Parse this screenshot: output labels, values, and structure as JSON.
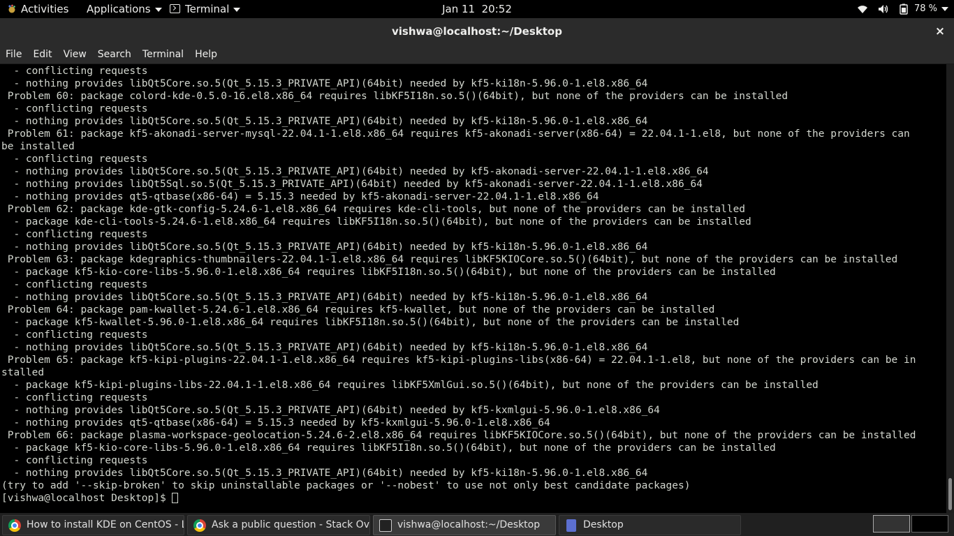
{
  "topbar": {
    "activities": "Activities",
    "applications": "Applications",
    "terminal": "Terminal",
    "clock": "Jan 11  20:52",
    "battery": "78 %"
  },
  "window": {
    "title": "vishwa@localhost:~/Desktop",
    "close": "×"
  },
  "menu": [
    "File",
    "Edit",
    "View",
    "Search",
    "Terminal",
    "Help"
  ],
  "terminal_lines": [
    "  - conflicting requests",
    "  - nothing provides libQt5Core.so.5(Qt_5.15.3_PRIVATE_API)(64bit) needed by kf5-ki18n-5.96.0-1.el8.x86_64",
    " Problem 60: package colord-kde-0.5.0-16.el8.x86_64 requires libKF5I18n.so.5()(64bit), but none of the providers can be installed",
    "  - conflicting requests",
    "  - nothing provides libQt5Core.so.5(Qt_5.15.3_PRIVATE_API)(64bit) needed by kf5-ki18n-5.96.0-1.el8.x86_64",
    " Problem 61: package kf5-akonadi-server-mysql-22.04.1-1.el8.x86_64 requires kf5-akonadi-server(x86-64) = 22.04.1-1.el8, but none of the providers can",
    "be installed",
    "  - conflicting requests",
    "  - nothing provides libQt5Core.so.5(Qt_5.15.3_PRIVATE_API)(64bit) needed by kf5-akonadi-server-22.04.1-1.el8.x86_64",
    "  - nothing provides libQt5Sql.so.5(Qt_5.15.3_PRIVATE_API)(64bit) needed by kf5-akonadi-server-22.04.1-1.el8.x86_64",
    "  - nothing provides qt5-qtbase(x86-64) = 5.15.3 needed by kf5-akonadi-server-22.04.1-1.el8.x86_64",
    " Problem 62: package kde-gtk-config-5.24.6-1.el8.x86_64 requires kde-cli-tools, but none of the providers can be installed",
    "  - package kde-cli-tools-5.24.6-1.el8.x86_64 requires libKF5I18n.so.5()(64bit), but none of the providers can be installed",
    "  - conflicting requests",
    "  - nothing provides libQt5Core.so.5(Qt_5.15.3_PRIVATE_API)(64bit) needed by kf5-ki18n-5.96.0-1.el8.x86_64",
    " Problem 63: package kdegraphics-thumbnailers-22.04.1-1.el8.x86_64 requires libKF5KIOCore.so.5()(64bit), but none of the providers can be installed",
    "  - package kf5-kio-core-libs-5.96.0-1.el8.x86_64 requires libKF5I18n.so.5()(64bit), but none of the providers can be installed",
    "  - conflicting requests",
    "  - nothing provides libQt5Core.so.5(Qt_5.15.3_PRIVATE_API)(64bit) needed by kf5-ki18n-5.96.0-1.el8.x86_64",
    " Problem 64: package pam-kwallet-5.24.6-1.el8.x86_64 requires kf5-kwallet, but none of the providers can be installed",
    "  - package kf5-kwallet-5.96.0-1.el8.x86_64 requires libKF5I18n.so.5()(64bit), but none of the providers can be installed",
    "  - conflicting requests",
    "  - nothing provides libQt5Core.so.5(Qt_5.15.3_PRIVATE_API)(64bit) needed by kf5-ki18n-5.96.0-1.el8.x86_64",
    " Problem 65: package kf5-kipi-plugins-22.04.1-1.el8.x86_64 requires kf5-kipi-plugins-libs(x86-64) = 22.04.1-1.el8, but none of the providers can be in",
    "stalled",
    "  - package kf5-kipi-plugins-libs-22.04.1-1.el8.x86_64 requires libKF5XmlGui.so.5()(64bit), but none of the providers can be installed",
    "  - conflicting requests",
    "  - nothing provides libQt5Core.so.5(Qt_5.15.3_PRIVATE_API)(64bit) needed by kf5-kxmlgui-5.96.0-1.el8.x86_64",
    "  - nothing provides qt5-qtbase(x86-64) = 5.15.3 needed by kf5-kxmlgui-5.96.0-1.el8.x86_64",
    " Problem 66: package plasma-workspace-geolocation-5.24.6-2.el8.x86_64 requires libKF5KIOCore.so.5()(64bit), but none of the providers can be installed",
    "  - package kf5-kio-core-libs-5.96.0-1.el8.x86_64 requires libKF5I18n.so.5()(64bit), but none of the providers can be installed",
    "  - conflicting requests",
    "  - nothing provides libQt5Core.so.5(Qt_5.15.3_PRIVATE_API)(64bit) needed by kf5-ki18n-5.96.0-1.el8.x86_64",
    "(try to add '--skip-broken' to skip uninstallable packages or '--nobest' to use not only best candidate packages)"
  ],
  "prompt": "[vishwa@localhost Desktop]$ ",
  "taskbar": [
    {
      "label": "How to install KDE on CentOS - L...",
      "icon": "chrome-icon"
    },
    {
      "label": "Ask a public question - Stack Over...",
      "icon": "chrome-icon"
    },
    {
      "label": "vishwa@localhost:~/Desktop",
      "icon": "terminal-icon"
    },
    {
      "label": "Desktop",
      "icon": "folder-icon"
    }
  ]
}
